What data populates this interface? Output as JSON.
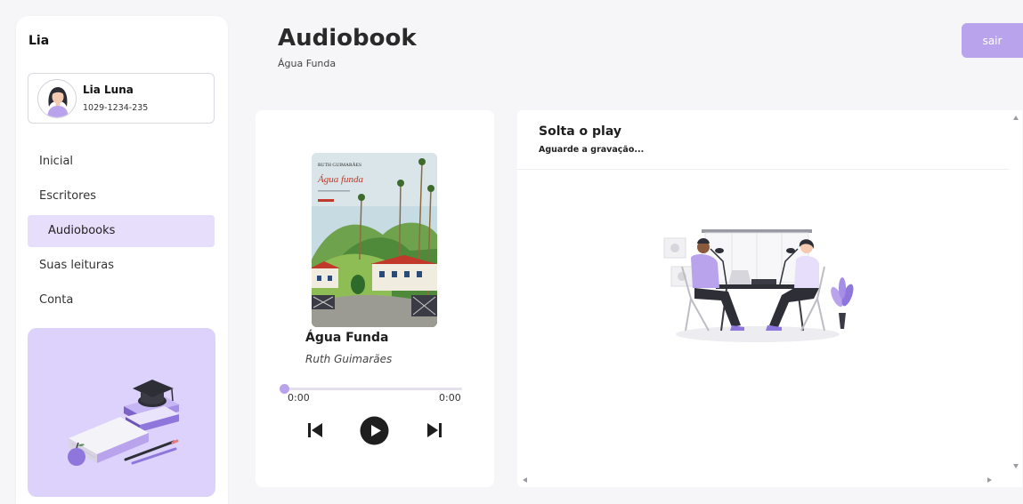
{
  "sidebar": {
    "brand": "Lia",
    "profile": {
      "name": "Lia Luna",
      "id": "1029-1234-235"
    },
    "nav": [
      {
        "label": "Inicial",
        "active": false
      },
      {
        "label": "Escritores",
        "active": false
      },
      {
        "label": "Audiobooks",
        "active": true
      },
      {
        "label": "Suas leituras",
        "active": false
      },
      {
        "label": "Conta",
        "active": false
      }
    ]
  },
  "header": {
    "title": "Audiobook",
    "subtitle": "Água Funda",
    "logout_label": "sair"
  },
  "player": {
    "cover": {
      "author_line": "RUTH GUIMARÃES",
      "title_line": "Água funda"
    },
    "book_title": "Água Funda",
    "author": "Ruth Guimarães",
    "current_time": "0:00",
    "duration": "0:00",
    "progress": 0
  },
  "recording": {
    "title": "Solta o play",
    "subtitle": "Aguarde a gravação..."
  },
  "colors": {
    "accent": "#b9a3ec",
    "accent_light": "#e6defa",
    "promo_bg": "#dcd2fb",
    "background": "#f6f6f8"
  },
  "icons": {
    "prev": "skip-previous-icon",
    "play": "play-icon",
    "next": "skip-next-icon"
  }
}
